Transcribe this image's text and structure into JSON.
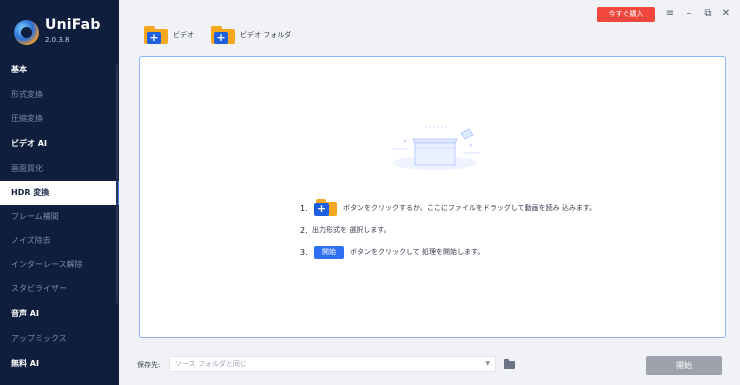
{
  "app": {
    "name": "UniFab",
    "version": "2.0.3.8"
  },
  "sidebar": {
    "items": [
      {
        "label": "基本",
        "type": "section"
      },
      {
        "label": "形式変換",
        "type": "item"
      },
      {
        "label": "圧縮変換",
        "type": "item"
      },
      {
        "label": "ビデオ AI",
        "type": "section"
      },
      {
        "label": "画面質化",
        "type": "item"
      },
      {
        "label": "HDR 変換",
        "type": "active"
      },
      {
        "label": "フレーム補間",
        "type": "item"
      },
      {
        "label": "ノイズ除去",
        "type": "item"
      },
      {
        "label": "インターレース解除",
        "type": "item"
      },
      {
        "label": "スタビライザー",
        "type": "item"
      },
      {
        "label": "音声 AI",
        "type": "section"
      },
      {
        "label": "アップミックス",
        "type": "item"
      },
      {
        "label": "無料 AI",
        "type": "section"
      }
    ]
  },
  "titlebar": {
    "buy_label": "今すぐ購入",
    "menu_icon": "≡",
    "minimize_icon": "–",
    "restore_icon": "⧉",
    "close_icon": "✕"
  },
  "toolbar": {
    "add_video_label": "ビデオ",
    "add_folder_label": "ビデオ フォルダ"
  },
  "steps": [
    {
      "num": "1.",
      "text": "ボタンをクリックするか、ここにファイルをドラッグして動画を読み 込みます。"
    },
    {
      "num": "2.",
      "text": "出力形式を 選択します。"
    },
    {
      "num": "3.",
      "chip": "開始",
      "text": "ボタンをクリックして 処理を開始します。"
    }
  ],
  "footer": {
    "save_label": "保存先:",
    "save_placeholder": "ソース フォルダと同じ",
    "start_label": "開始"
  },
  "colors": {
    "sidebar_bg": "#0f1e3d",
    "accent": "#2e6ff2",
    "buy": "#f2473c",
    "folder": "#f6a71e",
    "start_disabled": "#9ea2ac"
  }
}
